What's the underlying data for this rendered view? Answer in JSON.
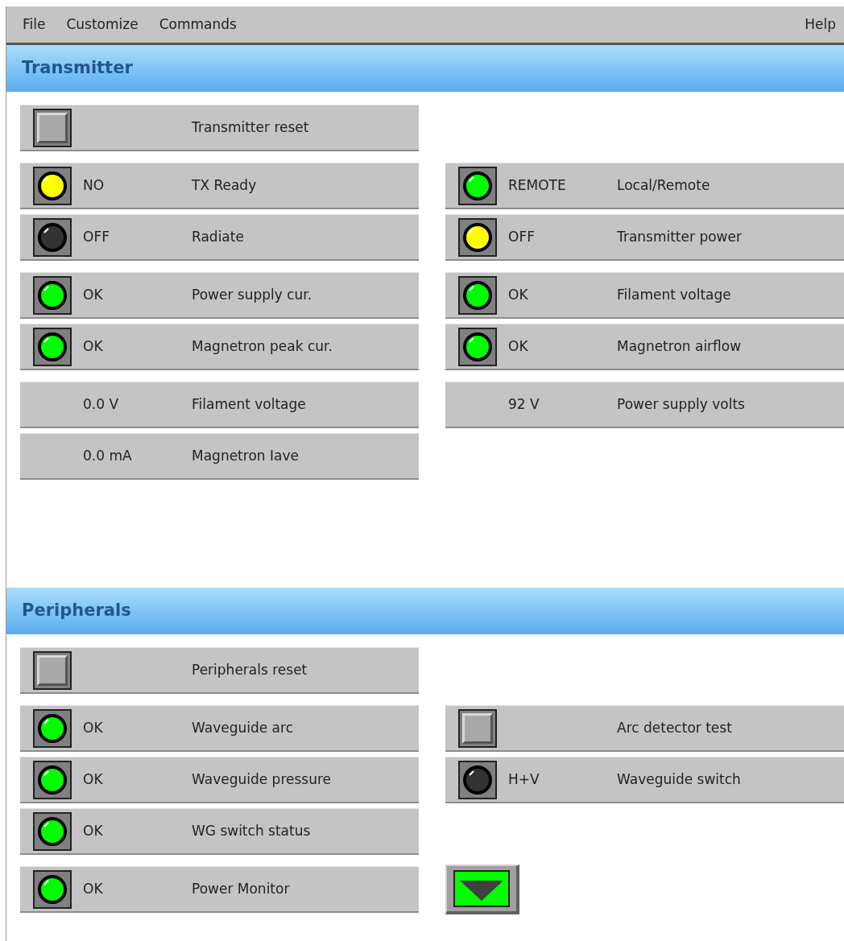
{
  "menu": {
    "left": [
      "File",
      "Customize",
      "Commands"
    ],
    "right": [
      "Help"
    ]
  },
  "sections": [
    {
      "title": "Transmitter",
      "groups": [
        [
          {
            "left": {
              "kind": "button",
              "label": "Transmitter reset"
            }
          }
        ],
        [
          {
            "left": {
              "kind": "lamp",
              "color": "#ffff00",
              "value": "NO",
              "label": "TX Ready"
            },
            "right": {
              "kind": "lamp",
              "color": "#00ff00",
              "value": "REMOTE",
              "label": "Local/Remote"
            }
          },
          {
            "left": {
              "kind": "lamp",
              "color": "#333333",
              "value": "OFF",
              "label": "Radiate"
            },
            "right": {
              "kind": "lamp",
              "color": "#ffff00",
              "value": "OFF",
              "label": "Transmitter power"
            }
          }
        ],
        [
          {
            "left": {
              "kind": "lamp",
              "color": "#00ff00",
              "value": "OK",
              "label": "Power supply cur."
            },
            "right": {
              "kind": "lamp",
              "color": "#00ff00",
              "value": "OK",
              "label": "Filament voltage"
            }
          },
          {
            "left": {
              "kind": "lamp",
              "color": "#00ff00",
              "value": "OK",
              "label": "Magnetron peak cur."
            },
            "right": {
              "kind": "lamp",
              "color": "#00ff00",
              "value": "OK",
              "label": "Magnetron airflow"
            }
          }
        ],
        [
          {
            "left": {
              "kind": "reading",
              "value": "0.0 V",
              "label": "Filament voltage"
            },
            "right": {
              "kind": "reading",
              "value": "92 V",
              "label": "Power supply volts"
            }
          },
          {
            "left": {
              "kind": "reading",
              "value": "0.0 mA",
              "label": "Magnetron Iave"
            }
          }
        ]
      ]
    },
    {
      "title": "Peripherals",
      "groups": [
        [
          {
            "left": {
              "kind": "button",
              "label": "Peripherals reset"
            }
          }
        ],
        [
          {
            "left": {
              "kind": "lamp",
              "color": "#00ff00",
              "value": "OK",
              "label": "Waveguide arc"
            },
            "right": {
              "kind": "button",
              "label": "Arc detector test"
            }
          },
          {
            "left": {
              "kind": "lamp",
              "color": "#00ff00",
              "value": "OK",
              "label": "Waveguide pressure"
            },
            "right": {
              "kind": "lamp",
              "color": "#333333",
              "value": "H+V",
              "label": "Waveguide switch"
            }
          },
          {
            "left": {
              "kind": "lamp",
              "color": "#00ff00",
              "value": "OK",
              "label": "WG switch status"
            }
          }
        ],
        [
          {
            "left": {
              "kind": "lamp",
              "color": "#00ff00",
              "value": "OK",
              "label": "Power Monitor"
            },
            "right": {
              "kind": "arrow"
            }
          }
        ]
      ]
    }
  ]
}
